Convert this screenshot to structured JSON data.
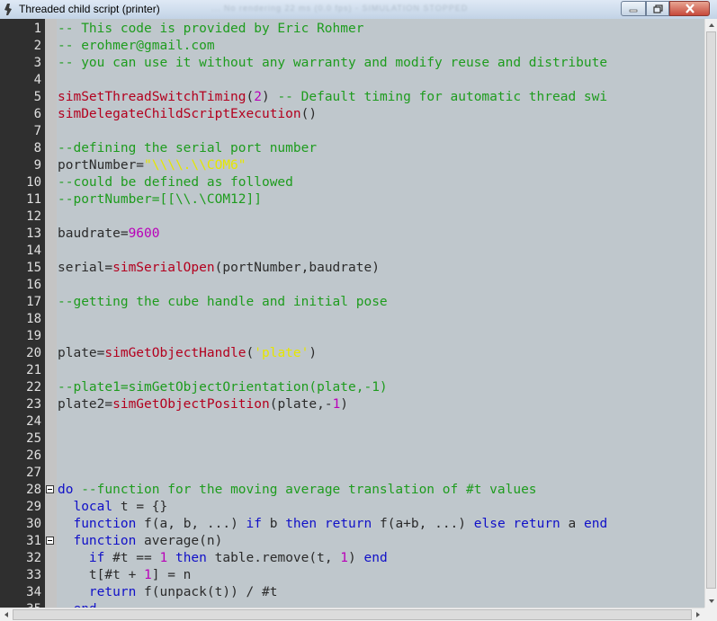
{
  "window": {
    "title": "Threaded child script (printer)",
    "background_title_text": "... No rendering 22 ms (0.0 fps) - SIMULATION STOPPED"
  },
  "colors": {
    "editor_bg": "#bfc7cc",
    "gutter_bg": "#2f2f2f",
    "comment": "#1e9c1e",
    "function": "#b3001e",
    "number": "#b900b9",
    "string": "#e6e600",
    "keyword": "#1010c8"
  },
  "editor": {
    "lines": [
      {
        "n": "1",
        "tokens": [
          {
            "t": "-- This code is provided by Eric Rohmer",
            "c": "comment"
          }
        ]
      },
      {
        "n": "2",
        "tokens": [
          {
            "t": "-- erohmer@gmail.com",
            "c": "comment"
          }
        ]
      },
      {
        "n": "3",
        "tokens": [
          {
            "t": "-- you can use it without any warranty and modify reuse and distribute",
            "c": "comment"
          }
        ]
      },
      {
        "n": "4",
        "tokens": []
      },
      {
        "n": "5",
        "tokens": [
          {
            "t": "simSetThreadSwitchTiming",
            "c": "func"
          },
          {
            "t": "(",
            "c": "plain"
          },
          {
            "t": "2",
            "c": "num"
          },
          {
            "t": ") ",
            "c": "plain"
          },
          {
            "t": "-- Default timing for automatic thread swi",
            "c": "comment"
          }
        ]
      },
      {
        "n": "6",
        "tokens": [
          {
            "t": "simDelegateChildScriptExecution",
            "c": "func"
          },
          {
            "t": "()",
            "c": "plain"
          }
        ]
      },
      {
        "n": "7",
        "tokens": []
      },
      {
        "n": "8",
        "tokens": [
          {
            "t": "--defining the serial port number",
            "c": "comment"
          }
        ]
      },
      {
        "n": "9",
        "tokens": [
          {
            "t": "portNumber=",
            "c": "plain"
          },
          {
            "t": "\"\\\\\\\\.\\\\COM6\"",
            "c": "str"
          }
        ]
      },
      {
        "n": "10",
        "tokens": [
          {
            "t": "--could be defined as followed",
            "c": "comment"
          }
        ]
      },
      {
        "n": "11",
        "tokens": [
          {
            "t": "--portNumber=[[\\\\.\\COM12]]",
            "c": "comment"
          }
        ]
      },
      {
        "n": "12",
        "tokens": []
      },
      {
        "n": "13",
        "tokens": [
          {
            "t": "baudrate=",
            "c": "plain"
          },
          {
            "t": "9600",
            "c": "num"
          }
        ]
      },
      {
        "n": "14",
        "tokens": []
      },
      {
        "n": "15",
        "tokens": [
          {
            "t": "serial=",
            "c": "plain"
          },
          {
            "t": "simSerialOpen",
            "c": "func"
          },
          {
            "t": "(portNumber,baudrate)",
            "c": "plain"
          }
        ]
      },
      {
        "n": "16",
        "tokens": []
      },
      {
        "n": "17",
        "tokens": [
          {
            "t": "--getting the cube handle and initial pose",
            "c": "comment"
          }
        ]
      },
      {
        "n": "18",
        "tokens": []
      },
      {
        "n": "19",
        "tokens": []
      },
      {
        "n": "20",
        "tokens": [
          {
            "t": "plate=",
            "c": "plain"
          },
          {
            "t": "simGetObjectHandle",
            "c": "func"
          },
          {
            "t": "(",
            "c": "plain"
          },
          {
            "t": "'plate'",
            "c": "str"
          },
          {
            "t": ")",
            "c": "plain"
          }
        ]
      },
      {
        "n": "21",
        "tokens": []
      },
      {
        "n": "22",
        "tokens": [
          {
            "t": "--plate1=simGetObjectOrientation(plate,-1)",
            "c": "comment"
          }
        ]
      },
      {
        "n": "23",
        "tokens": [
          {
            "t": "plate2=",
            "c": "plain"
          },
          {
            "t": "simGetObjectPosition",
            "c": "func"
          },
          {
            "t": "(plate,-",
            "c": "plain"
          },
          {
            "t": "1",
            "c": "num"
          },
          {
            "t": ")",
            "c": "plain"
          }
        ]
      },
      {
        "n": "24",
        "tokens": []
      },
      {
        "n": "25",
        "tokens": []
      },
      {
        "n": "26",
        "tokens": []
      },
      {
        "n": "27",
        "tokens": []
      },
      {
        "n": "28",
        "fold": true,
        "tokens": [
          {
            "t": "do",
            "c": "kw"
          },
          {
            "t": " ",
            "c": "plain"
          },
          {
            "t": "--function for the moving average translation of #t values",
            "c": "comment"
          }
        ]
      },
      {
        "n": "29",
        "tokens": [
          {
            "t": "  ",
            "c": "plain"
          },
          {
            "t": "local",
            "c": "kw"
          },
          {
            "t": " t = {}",
            "c": "plain"
          }
        ]
      },
      {
        "n": "30",
        "tokens": [
          {
            "t": "  ",
            "c": "plain"
          },
          {
            "t": "function",
            "c": "kw"
          },
          {
            "t": " f(a, b, ...) ",
            "c": "plain"
          },
          {
            "t": "if",
            "c": "kw"
          },
          {
            "t": " b ",
            "c": "plain"
          },
          {
            "t": "then",
            "c": "kw"
          },
          {
            "t": " ",
            "c": "plain"
          },
          {
            "t": "return",
            "c": "kw"
          },
          {
            "t": " f(a+b, ...) ",
            "c": "plain"
          },
          {
            "t": "else",
            "c": "kw"
          },
          {
            "t": " ",
            "c": "plain"
          },
          {
            "t": "return",
            "c": "kw"
          },
          {
            "t": " a ",
            "c": "plain"
          },
          {
            "t": "end",
            "c": "kw"
          }
        ]
      },
      {
        "n": "31",
        "fold": true,
        "tokens": [
          {
            "t": "  ",
            "c": "plain"
          },
          {
            "t": "function",
            "c": "kw"
          },
          {
            "t": " average(n)",
            "c": "plain"
          }
        ]
      },
      {
        "n": "32",
        "tokens": [
          {
            "t": "    ",
            "c": "plain"
          },
          {
            "t": "if",
            "c": "kw"
          },
          {
            "t": " #t == ",
            "c": "plain"
          },
          {
            "t": "1",
            "c": "num"
          },
          {
            "t": " ",
            "c": "plain"
          },
          {
            "t": "then",
            "c": "kw"
          },
          {
            "t": " table.remove(t, ",
            "c": "plain"
          },
          {
            "t": "1",
            "c": "num"
          },
          {
            "t": ") ",
            "c": "plain"
          },
          {
            "t": "end",
            "c": "kw"
          }
        ]
      },
      {
        "n": "33",
        "tokens": [
          {
            "t": "    t[#t + ",
            "c": "plain"
          },
          {
            "t": "1",
            "c": "num"
          },
          {
            "t": "] = n",
            "c": "plain"
          }
        ]
      },
      {
        "n": "34",
        "tokens": [
          {
            "t": "    ",
            "c": "plain"
          },
          {
            "t": "return",
            "c": "kw"
          },
          {
            "t": " f(unpack(t)) / #t",
            "c": "plain"
          }
        ]
      },
      {
        "n": "35",
        "tokens": [
          {
            "t": "  ",
            "c": "plain"
          },
          {
            "t": "end",
            "c": "kw"
          }
        ]
      }
    ]
  }
}
